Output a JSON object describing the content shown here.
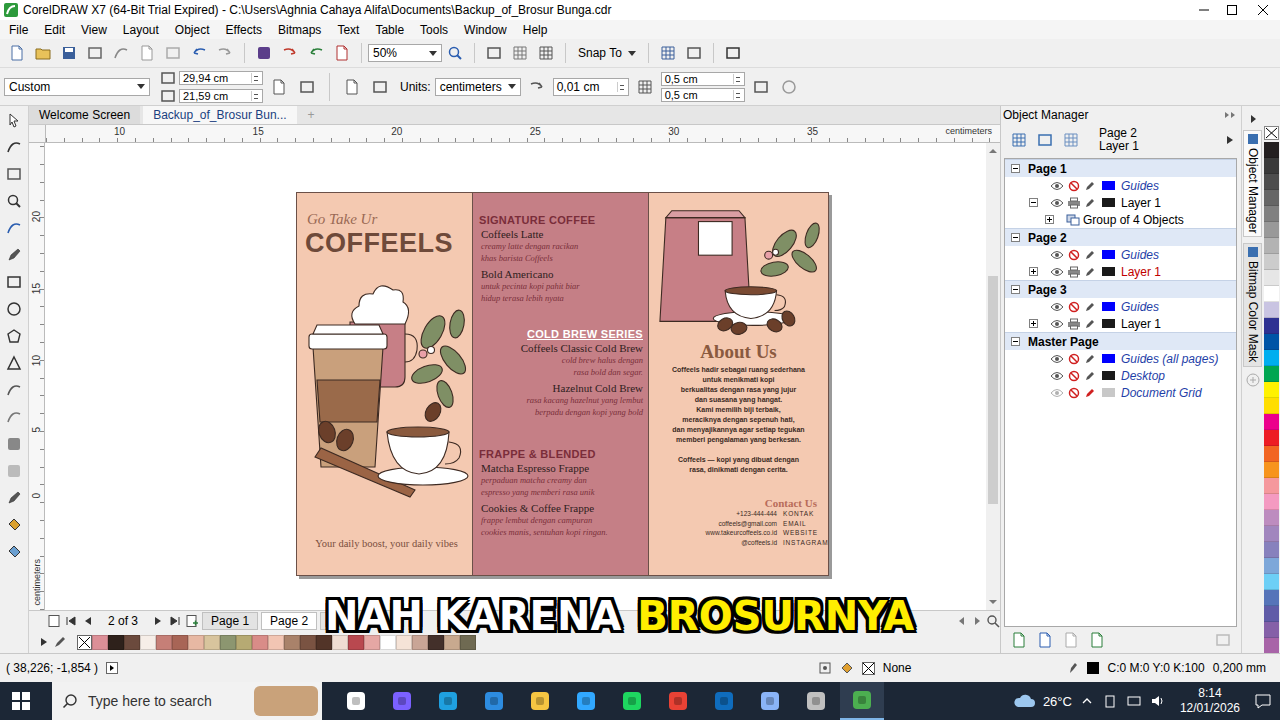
{
  "window": {
    "title": "CorelDRAW X7 (64-Bit Trial Expired) - C:\\Users\\Aghnia Cahaya Alifa\\Documents\\Backup_of_Brosur Bunga.cdr"
  },
  "menu": [
    "File",
    "Edit",
    "View",
    "Layout",
    "Object",
    "Effects",
    "Bitmaps",
    "Text",
    "Table",
    "Tools",
    "Window",
    "Help"
  ],
  "toolbar": {
    "zoom": "50%",
    "snap": "Snap To"
  },
  "property_bar": {
    "preset": "Custom",
    "width": "29,94 cm",
    "height": "21,59 cm",
    "units_label": "Units:",
    "units": "centimeters",
    "nudge": "0,01 cm",
    "dup_x": "0,5 cm",
    "dup_y": "0,5 cm"
  },
  "doc_tabs": [
    {
      "label": "Welcome Screen",
      "selected": false
    },
    {
      "label": "Backup_of_Brosur Bun...",
      "selected": true
    }
  ],
  "tab_add": "+",
  "ruler": {
    "h_ticks": [
      "10",
      "15",
      "20",
      "25",
      "30",
      "35"
    ],
    "h_unit": "centimeters",
    "v_ticks": [
      "20",
      "15",
      "10",
      "5",
      "0"
    ],
    "v_unit": "centimeters"
  },
  "vscroll": {
    "start": 0.27,
    "level": 0.52
  },
  "brochure": {
    "tagline": "Go Take Ur",
    "brand": "COFFEELS",
    "slogan": "Your daily boost, your daily vibes",
    "sections": [
      {
        "heading": "SIGNATURE COFFEE",
        "kind": "dark",
        "items": [
          {
            "name": "Coffeels Latte",
            "desc": [
              "creamy latte dengan racikan",
              "khas barista Coffeels"
            ]
          },
          {
            "name": "Bold Americano",
            "desc": [
              "untuk pecinta kopi pahit biar",
              "hidup terasa lebih nyata"
            ]
          }
        ]
      },
      {
        "heading": "COLD BREW SERIES",
        "kind": "light",
        "items": [
          {
            "name": "Coffeels Classic Cold Brew",
            "desc": [
              "cold brew halus dengan",
              "rasa bold dan segar."
            ]
          },
          {
            "name": "Hazelnut Cold Brew",
            "desc": [
              "rasa kacang hazelnut yang lembut",
              "berpadu dengan kopi yang bold"
            ]
          }
        ]
      },
      {
        "heading": "FRAPPE & BLENDED",
        "kind": "dark",
        "items": [
          {
            "name": "Matcha Espresso Frappe",
            "desc": [
              "perpaduan matcha creamy dan",
              "espresso yang memberi rasa unik"
            ]
          },
          {
            "name": "Cookies & Coffee Frappe",
            "desc": [
              "frappe lembut dengan campuran",
              "cookies manis, sentuhan kopi ringan."
            ]
          }
        ]
      }
    ],
    "about_title": "About Us",
    "about_lines": [
      "Coffeels hadir sebagai ruang sederhana",
      "untuk menikmati kopi",
      "berkualitas dengan rasa yang jujur",
      "dan suasana yang hangat.",
      "Kami memilih biji terbaik,",
      "meraciknya dengan sepenuh hati,",
      "dan menyajikannya agar setiap tegukan",
      "memberi pengalaman yang berkesan."
    ],
    "about_closing": [
      "Coffeels — kopi yang dibuat dengan",
      "rasa, dinikmati dengan cerita."
    ],
    "contact_title": "Contact Us",
    "contacts": [
      {
        "value": "+123-444-444",
        "label": "KONTAK"
      },
      {
        "value": "coffeels@gmail.com",
        "label": "EMAIL"
      },
      {
        "value": "www.takeurcoffeels.co.id",
        "label": "WEBSITE"
      },
      {
        "value": "@coffeels.id",
        "label": "INSTAGRAM"
      }
    ]
  },
  "page_nav": {
    "counter": "2 of 3",
    "pages": [
      {
        "label": "Page 1",
        "selected": false
      },
      {
        "label": "Page 2",
        "selected": true
      },
      {
        "label": "P",
        "selected": false
      }
    ]
  },
  "caption": {
    "words": [
      {
        "text": "NAH KARENA",
        "highlight": false
      },
      {
        "text": "BROSURNYA",
        "highlight": true
      }
    ]
  },
  "palette_bottom": [
    "#dc8f97",
    "#2e211b",
    "#6b4a3d",
    "#f6eee8",
    "#c67f77",
    "#a86556",
    "#e7b8a3",
    "#d8c49d",
    "#8c9670",
    "#b6aa73",
    "#d98c88",
    "#f2c5b3",
    "#a9826a",
    "#7a5342",
    "#523428",
    "#f0ddd2",
    "#b9484f",
    "#e5a7a4",
    "#ffffff",
    "#f5e3d7",
    "#c9a596",
    "#43302a",
    "#c8a98f",
    "#6f6a52"
  ],
  "palette_right": [
    "#231f20",
    "#3a3a3a",
    "#4d4d4d",
    "#666666",
    "#808080",
    "#999999",
    "#b3b3b3",
    "#cccccc",
    "#e6e6e6",
    "#ffffff",
    "#c9c4e2",
    "#2e3192",
    "#0054a6",
    "#00aeef",
    "#00a651",
    "#fff200",
    "#ffde00",
    "#ec008c",
    "#ed1c24",
    "#f26522",
    "#f7941d",
    "#f5989d",
    "#f49ac1",
    "#bd8cbf",
    "#a186be",
    "#8781bd",
    "#7da7d9",
    "#6dcff6",
    "#5674b9",
    "#605ca8",
    "#8560a8",
    "#a864a8"
  ],
  "status_bar": {
    "coords": "( 38,226; -1,854 )",
    "fill": "None",
    "outline": "C:0 M:0 Y:0 K:100",
    "outline_width": "0,200 mm"
  },
  "object_manager": {
    "title": "Object Manager",
    "current_page": "Page 2",
    "current_layer": "Layer 1",
    "pages": [
      {
        "label": "Page 1",
        "expanded": true,
        "layers": [
          {
            "label": "Guides",
            "kind": "guides",
            "color": "#0000ff",
            "visible": true,
            "printable": false,
            "expandable": false,
            "expanded": false,
            "active": false,
            "children": []
          },
          {
            "label": "Layer 1",
            "kind": "layer",
            "color": "#1a1a1a",
            "visible": true,
            "printable": true,
            "expandable": true,
            "expanded": true,
            "active": false,
            "children": [
              {
                "label": "Group of 4 Objects",
                "expandable": true,
                "expanded": false
              }
            ]
          }
        ]
      },
      {
        "label": "Page 2",
        "expanded": true,
        "layers": [
          {
            "label": "Guides",
            "kind": "guides",
            "color": "#0000ff",
            "visible": true,
            "printable": false,
            "expandable": false,
            "expanded": false,
            "active": false,
            "children": []
          },
          {
            "label": "Layer 1",
            "kind": "layer",
            "color": "#1a1a1a",
            "visible": true,
            "printable": true,
            "expandable": true,
            "expanded": false,
            "active": true,
            "children": []
          }
        ]
      },
      {
        "label": "Page 3",
        "expanded": true,
        "layers": [
          {
            "label": "Guides",
            "kind": "guides",
            "color": "#0000ff",
            "visible": true,
            "printable": false,
            "expandable": false,
            "expanded": false,
            "active": false,
            "children": []
          },
          {
            "label": "Layer 1",
            "kind": "layer",
            "color": "#1a1a1a",
            "visible": true,
            "printable": true,
            "expandable": true,
            "expanded": false,
            "active": false,
            "children": []
          }
        ]
      },
      {
        "label": "Master Page",
        "expanded": true,
        "layers": [
          {
            "label": "Guides (all pages)",
            "kind": "master",
            "color": "#0000ff",
            "visible": true,
            "printable": false,
            "expandable": false,
            "expanded": false,
            "active": false,
            "children": []
          },
          {
            "label": "Desktop",
            "kind": "master",
            "color": "#1a1a1a",
            "visible": true,
            "printable": false,
            "expandable": false,
            "expanded": false,
            "active": false,
            "children": []
          },
          {
            "label": "Document Grid",
            "kind": "master",
            "color": "#c8c8c8",
            "visible": false,
            "printable": false,
            "expandable": false,
            "expanded": false,
            "active": false,
            "children": []
          }
        ]
      }
    ]
  },
  "docker_tabs": [
    {
      "label": "Object Manager",
      "selected": true
    },
    {
      "label": "Bitmap Color Mask",
      "selected": false
    }
  ],
  "taskbar": {
    "search": "Type here to search",
    "weather": "26°C",
    "time": "8:14",
    "date": "12/01/2026",
    "apps": [
      {
        "color": "#ffffff",
        "active": false
      },
      {
        "color": "#7b61ff",
        "active": false
      },
      {
        "color": "#1fa0e0",
        "active": false
      },
      {
        "color": "#2d8ce0",
        "active": false
      },
      {
        "color": "#f5c542",
        "active": false
      },
      {
        "color": "#31a8ff",
        "active": false
      },
      {
        "color": "#1ed760",
        "active": false
      },
      {
        "color": "#e94235",
        "active": false
      },
      {
        "color": "#0f6cbd",
        "active": false
      },
      {
        "color": "#8ab4f8",
        "active": false
      },
      {
        "color": "#c0c0c0",
        "active": false
      },
      {
        "color": "#4caf50",
        "active": true
      }
    ]
  }
}
